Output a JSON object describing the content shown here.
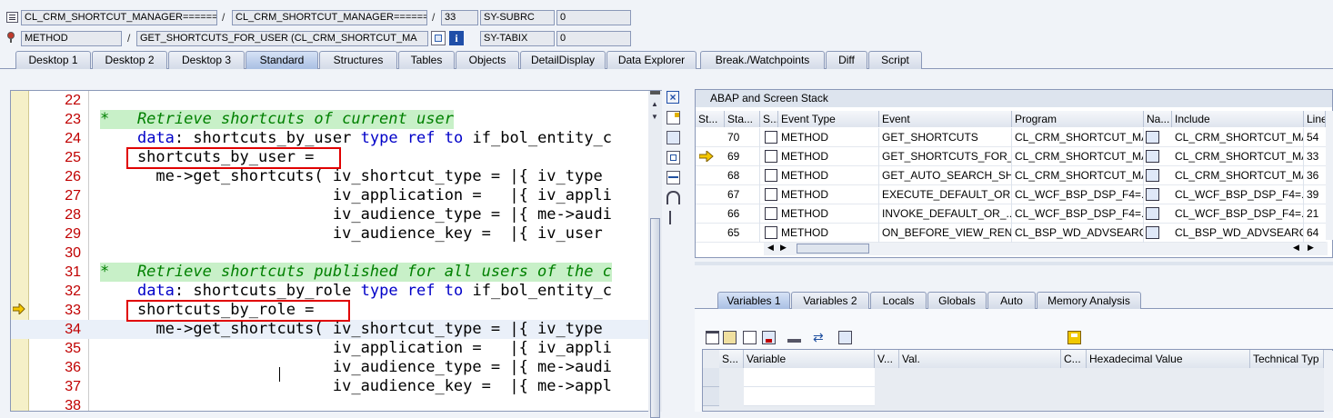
{
  "header": {
    "row1": {
      "class_field": "CL_CRM_SHORTCUT_MANAGER======",
      "class_field2": "CL_CRM_SHORTCUT_MANAGER======",
      "line": "33",
      "var_name": "SY-SUBRC",
      "var_value": "0"
    },
    "row2": {
      "type_field": "METHOD",
      "method_field": "GET_SHORTCUTS_FOR_USER (CL_CRM_SHORTCUT_MA",
      "var_name": "SY-TABIX",
      "var_value": "0"
    },
    "sep": "/"
  },
  "tabs": [
    "Desktop 1",
    "Desktop 2",
    "Desktop 3",
    "Standard",
    "Structures",
    "Tables",
    "Objects",
    "DetailDisplay",
    "Data Explorer",
    "Break./Watchpoints",
    "Diff",
    "Script"
  ],
  "active_tab": "Standard",
  "code": {
    "lines": [
      {
        "num": "22",
        "text": ""
      },
      {
        "num": "23",
        "text": "*   Retrieve shortcuts of current user"
      },
      {
        "num": "24",
        "text": "    data: shortcuts_by_user type ref to if_bol_entity_c"
      },
      {
        "num": "25",
        "text": "    shortcuts_by_user ="
      },
      {
        "num": "26",
        "text": "      me->get_shortcuts( iv_shortcut_type = |{ iv_type"
      },
      {
        "num": "27",
        "text": "                         iv_application =   |{ iv_appli"
      },
      {
        "num": "28",
        "text": "                         iv_audience_type = |{ me->audi"
      },
      {
        "num": "29",
        "text": "                         iv_audience_key =  |{ iv_user"
      },
      {
        "num": "30",
        "text": ""
      },
      {
        "num": "31",
        "text": "*   Retrieve shortcuts published for all users of the c"
      },
      {
        "num": "32",
        "text": "    data: shortcuts_by_role type ref to if_bol_entity_c"
      },
      {
        "num": "33",
        "text": "    shortcuts_by_role ="
      },
      {
        "num": "34",
        "text": "      me->get_shortcuts( iv_shortcut_type = |{ iv_type"
      },
      {
        "num": "35",
        "text": "                         iv_application =   |{ iv_appli"
      },
      {
        "num": "36",
        "text": "                         iv_audience_type = |{ me->audi"
      },
      {
        "num": "37",
        "text": "                         iv_audience_key =  |{ me->appl"
      },
      {
        "num": "38",
        "text": ""
      }
    ],
    "current_line": "33"
  },
  "stack": {
    "title": "ABAP and Screen Stack",
    "columns": [
      "St...",
      "Sta...",
      "S...",
      "Event Type",
      "Event",
      "Program",
      "Na...",
      "Include",
      "Line"
    ],
    "rows": [
      {
        "level": "70",
        "event_type": "METHOD",
        "event": "GET_SHORTCUTS",
        "program": "CL_CRM_SHORTCUT_MA...",
        "include": "CL_CRM_SHORTCUT_MA...",
        "line": "54",
        "current": false
      },
      {
        "level": "69",
        "event_type": "METHOD",
        "event": "GET_SHORTCUTS_FOR_...",
        "program": "CL_CRM_SHORTCUT_MA...",
        "include": "CL_CRM_SHORTCUT_MA...",
        "line": "33",
        "current": true
      },
      {
        "level": "68",
        "event_type": "METHOD",
        "event": "GET_AUTO_SEARCH_SH...",
        "program": "CL_CRM_SHORTCUT_MA...",
        "include": "CL_CRM_SHORTCUT_MA...",
        "line": "36",
        "current": false
      },
      {
        "level": "67",
        "event_type": "METHOD",
        "event": "EXECUTE_DEFAULT_OR...",
        "program": "CL_WCF_BSP_DSP_F4=...",
        "include": "CL_WCF_BSP_DSP_F4=...",
        "line": "39",
        "current": false
      },
      {
        "level": "66",
        "event_type": "METHOD",
        "event": "INVOKE_DEFAULT_OR_...",
        "program": "CL_WCF_BSP_DSP_F4=...",
        "include": "CL_WCF_BSP_DSP_F4=...",
        "line": "21",
        "current": false
      },
      {
        "level": "65",
        "event_type": "METHOD",
        "event": "ON_BEFORE_VIEW_REN...",
        "program": "CL_BSP_WD_ADVSEARC...",
        "include": "CL_BSP_WD_ADVSEARC...",
        "line": "64",
        "current": false
      }
    ]
  },
  "var_tabs": [
    "Variables 1",
    "Variables 2",
    "Locals",
    "Globals",
    "Auto",
    "Memory Analysis"
  ],
  "var_active": "Variables 1",
  "var_columns": [
    "S...",
    "Variable",
    "V...",
    "Val.",
    "C...",
    "Hexadecimal Value",
    "Technical Typ"
  ],
  "colors": {
    "keyword": "#0000c8",
    "comment": "#008000",
    "line_number": "#c00000",
    "highlight": "#e00000"
  }
}
